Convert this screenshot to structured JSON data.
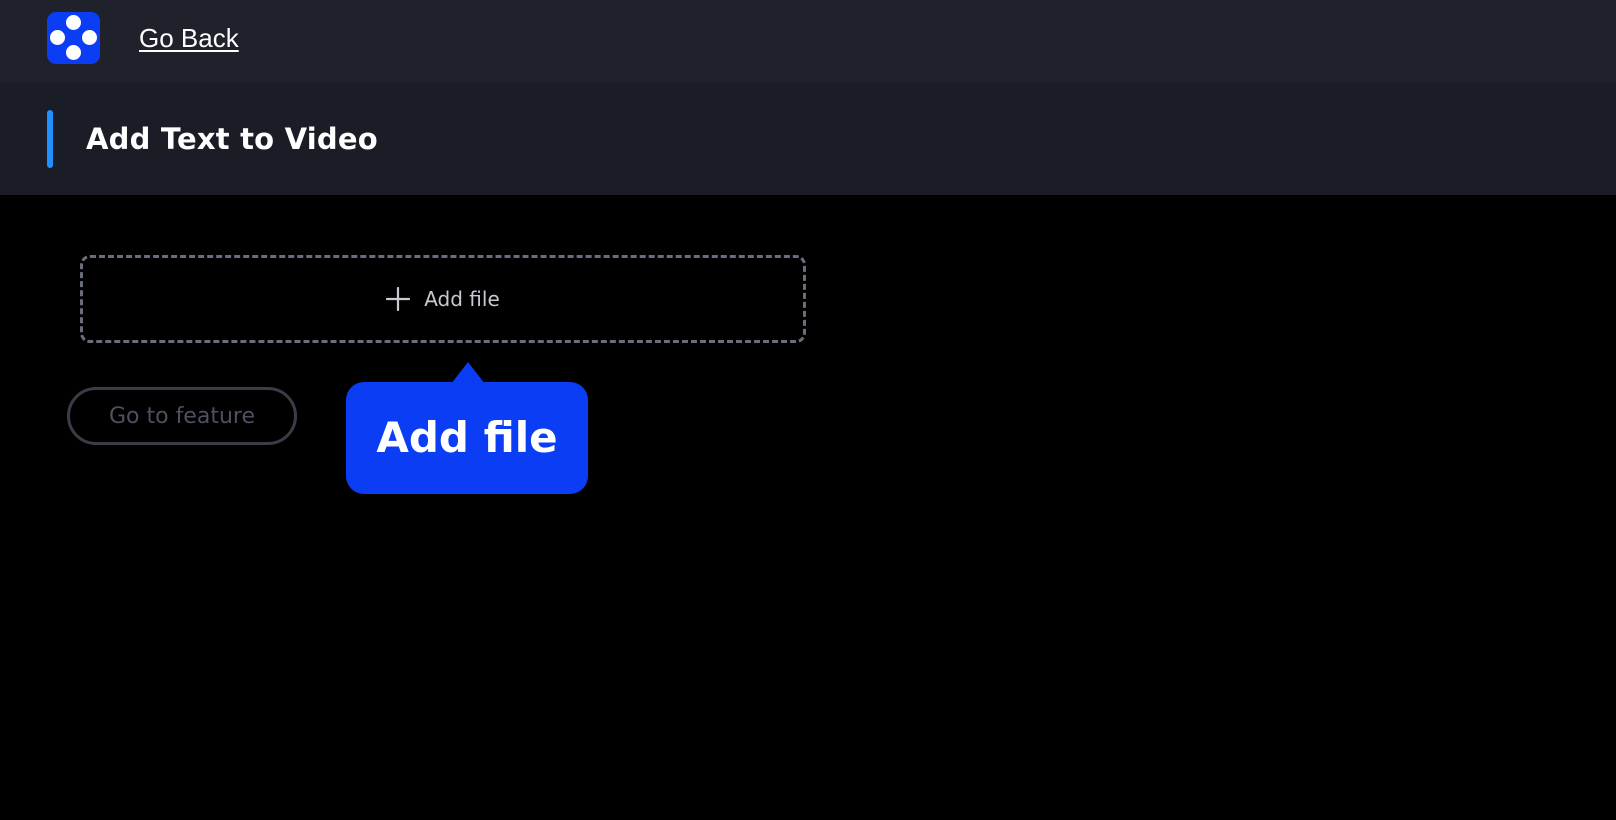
{
  "topbar": {
    "logo_icon": "app-logo-four-dots-icon",
    "back_link": "Go Back"
  },
  "header": {
    "title": "Add Text to Video",
    "accent_color": "#1e90ff"
  },
  "upload": {
    "icon": "plus-icon",
    "label": "Add file"
  },
  "actions": {
    "go_to_feature_label": "Go to feature"
  },
  "tooltip": {
    "text": "Add file",
    "color": "#0b3df5"
  }
}
